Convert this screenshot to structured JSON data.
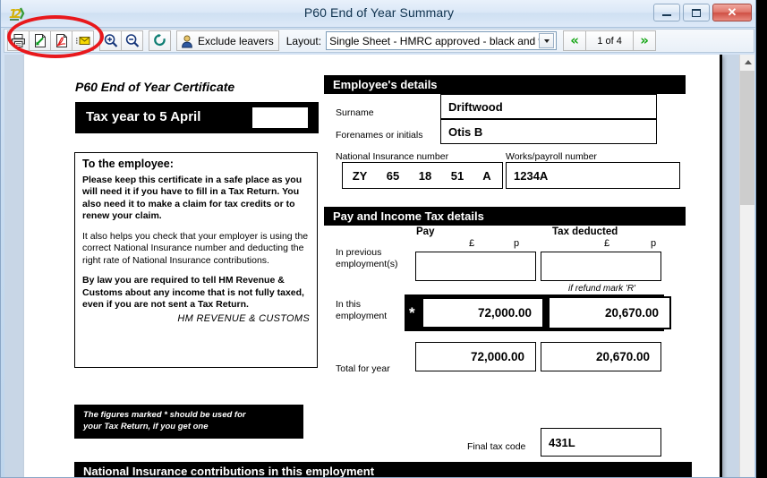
{
  "window": {
    "title": "P60 End of Year Summary",
    "app_icon": "payroll-app-icon",
    "minimize_label": "Minimize",
    "maximize_label": "Maximize",
    "close_label": "Close"
  },
  "toolbar": {
    "buttons": [
      {
        "name": "print-button",
        "icon": "printer-icon",
        "tooltip": "Print"
      },
      {
        "name": "export-button",
        "icon": "export-document-icon",
        "tooltip": "Export"
      },
      {
        "name": "pdf-button",
        "icon": "pdf-icon",
        "tooltip": "Save as PDF"
      },
      {
        "name": "email-button",
        "icon": "envelope-icon",
        "tooltip": "Email"
      },
      {
        "name": "zoom-in-button",
        "icon": "magnifier-plus-icon",
        "tooltip": "Zoom in"
      },
      {
        "name": "zoom-out-button",
        "icon": "magnifier-minus-icon",
        "tooltip": "Zoom out"
      },
      {
        "name": "refresh-button",
        "icon": "refresh-icon",
        "tooltip": "Refresh"
      }
    ],
    "exclude_leavers_label": "Exclude leavers",
    "layout_label": "Layout:",
    "layout_value": "Single Sheet - HMRC approved - black and white",
    "prev_page_icon": "double-chevron-left-icon",
    "next_page_icon": "double-chevron-right-icon",
    "page_indicator": "1 of 4",
    "annotation": {
      "name": "red-oval-highlight",
      "color": "#e8181c"
    }
  },
  "document": {
    "certificate_title": "P60 End of Year Certificate",
    "tax_year_label": "Tax year to 5 April",
    "tax_year_value": "",
    "employee_note": {
      "heading": "To the employee:",
      "paragraph1": "Please keep this certificate in a safe place as you will need it if you have to fill in a Tax Return. You also need it to make a claim for tax credits or to renew your claim.",
      "paragraph2": "It also helps you check that your employer is using the correct National Insurance number and deducting the right rate of National Insurance contributions.",
      "paragraph3": "By law you are required to tell HM Revenue & Customs about any income that is not fully taxed, even if you are not sent a Tax Return.",
      "signature": "HM REVENUE & CUSTOMS"
    },
    "star_note_line1": "The figures marked * should be used for",
    "star_note_line2": "your Tax Return, if you get one",
    "employee_details": {
      "section_title": "Employee's details",
      "surname_label": "Surname",
      "surname_value": "Driftwood",
      "forenames_label": "Forenames or initials",
      "forenames_value": "Otis  B",
      "ni_number_label": "National Insurance number",
      "ni_number_parts": [
        "ZY",
        "65",
        "18",
        "51",
        "A"
      ],
      "works_number_label": "Works/payroll number",
      "works_number_value": "1234A"
    },
    "pay_tax": {
      "section_title": "Pay and Income Tax details",
      "pay_header": "Pay",
      "tax_header": "Tax deducted",
      "pounds_symbol": "£",
      "pence_symbol": "p",
      "refund_note": "if refund mark 'R'",
      "rows": [
        {
          "label_line1": "In previous",
          "label_line2": "employment(s)",
          "pay": "",
          "tax": "",
          "starred": false
        },
        {
          "label_line1": "In this",
          "label_line2": "employment",
          "pay": "72,000.00",
          "tax": "20,670.00",
          "starred": true
        },
        {
          "label_line1": "Total for year",
          "label_line2": "",
          "pay": "72,000.00",
          "tax": "20,670.00",
          "starred": false
        }
      ],
      "star_symbol": "*"
    },
    "final_tax_code_label": "Final tax code",
    "final_tax_code_value": "431L",
    "ni_section_title": "National Insurance contributions in this employment"
  },
  "scrollbar": {
    "up_arrow_icon": "scroll-up-arrow-icon",
    "thumb": "vertical-scroll-thumb"
  }
}
